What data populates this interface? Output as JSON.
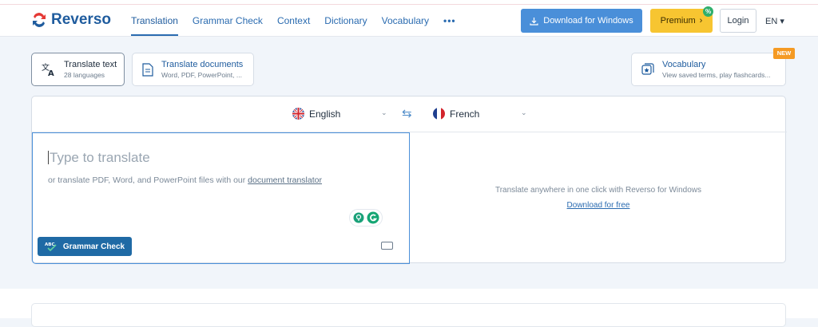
{
  "brand": {
    "name": "Reverso"
  },
  "nav": {
    "items": [
      {
        "label": "Translation"
      },
      {
        "label": "Grammar Check"
      },
      {
        "label": "Context"
      },
      {
        "label": "Dictionary"
      },
      {
        "label": "Vocabulary"
      }
    ],
    "more": "•••",
    "active_index": 0
  },
  "header": {
    "download_label": "Download for Windows",
    "premium_label": "Premium",
    "premium_badge": "%",
    "login_label": "Login",
    "ui_language": "EN ▾"
  },
  "modes": {
    "text": {
      "title": "Translate text",
      "subtitle": "28 languages"
    },
    "documents": {
      "title": "Translate documents",
      "subtitle": "Word, PDF, PowerPoint, ..."
    },
    "vocabulary": {
      "title": "Vocabulary",
      "subtitle": "View saved terms, play flashcards...",
      "badge": "NEW"
    }
  },
  "translator": {
    "source_language": "English",
    "target_language": "French",
    "chevron": "⌄",
    "swap": "⇆",
    "placeholder": "Type to translate",
    "hint_prefix": "or translate PDF, Word, and PowerPoint files with our ",
    "hint_link": "document translator",
    "grammar_button": "Grammar Check",
    "grammar_badge": "ABC",
    "promo_text": "Translate anywhere in one click with Reverso for Windows",
    "promo_link": "Download for free"
  },
  "colors": {
    "accent": "#4a8fd9",
    "brand": "#1f5c9e",
    "premium": "#f7c531",
    "new_badge": "#f59a23"
  }
}
